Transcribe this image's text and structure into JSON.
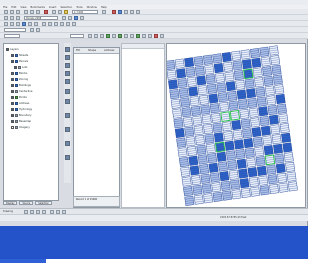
{
  "app": {
    "title": "",
    "menu": [
      "File",
      "Edit",
      "View",
      "Bookmarks",
      "Insert",
      "Selection",
      "Tools",
      "Window",
      "Help"
    ],
    "scale_value": "1:7,000",
    "layer_combo": "Parcels 2008"
  },
  "toc": {
    "items": [
      {
        "label": "Layers",
        "checked": true,
        "swatch": "none"
      },
      {
        "label": "Streets",
        "checked": true,
        "swatch": "blue"
      },
      {
        "label": "Parcels",
        "checked": true,
        "swatch": "blue"
      },
      {
        "label": "Lots",
        "checked": true,
        "swatch": "gray"
      },
      {
        "label": "Blocks",
        "checked": true,
        "swatch": "blue"
      },
      {
        "label": "Zoning",
        "checked": true,
        "swatch": "blue"
      },
      {
        "label": "Buildings",
        "checked": true,
        "swatch": "blue"
      },
      {
        "label": "Centerline",
        "checked": true,
        "swatch": "gray"
      },
      {
        "label": "Points",
        "checked": true,
        "swatch": "green"
      },
      {
        "label": "Address",
        "checked": true,
        "swatch": "blue"
      },
      {
        "label": "Hydrology",
        "checked": true,
        "swatch": "blue"
      },
      {
        "label": "Boundary",
        "checked": true,
        "swatch": "gray"
      },
      {
        "label": "Basemap",
        "checked": true,
        "swatch": "gray"
      },
      {
        "label": "Imagery",
        "checked": false,
        "swatch": "gray"
      }
    ],
    "tabs": [
      "Display",
      "Source",
      "Selection"
    ]
  },
  "attributes": {
    "headers": [
      "FID",
      "Shape",
      "Address"
    ],
    "footer": "Record 1 of 15000"
  },
  "status": {
    "left": "Drawing",
    "right": "2345.67  8765.43 Feet"
  },
  "colors": {
    "parcel_fill": "#2f63c8",
    "parcel_line": "#1a3f92",
    "taskbar": "#2452c9"
  }
}
